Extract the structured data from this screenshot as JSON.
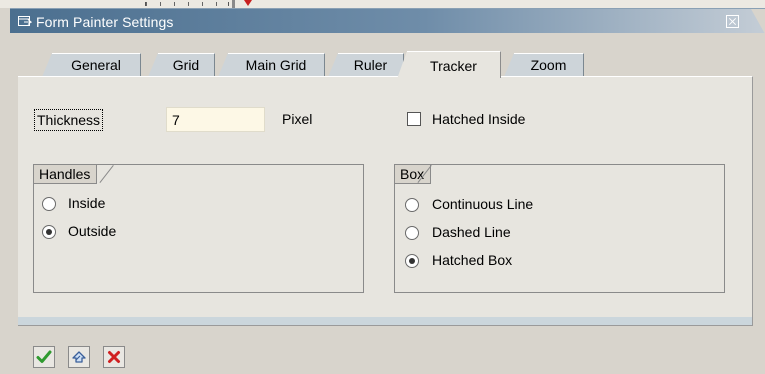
{
  "window": {
    "title": "Form Painter Settings"
  },
  "tabs": [
    {
      "label": "General",
      "active": false
    },
    {
      "label": "Grid",
      "active": false
    },
    {
      "label": "Main Grid",
      "active": false
    },
    {
      "label": "Ruler",
      "active": false
    },
    {
      "label": "Tracker",
      "active": true
    },
    {
      "label": "Zoom",
      "active": false
    }
  ],
  "tracker": {
    "thickness_label": "Thickness",
    "thickness_value": "7",
    "thickness_unit": "Pixel",
    "hatched_inside_label": "Hatched Inside",
    "hatched_inside_checked": false
  },
  "handles": {
    "title": "Handles",
    "options": [
      {
        "label": "Inside",
        "selected": false
      },
      {
        "label": "Outside",
        "selected": true
      }
    ]
  },
  "box": {
    "title": "Box",
    "options": [
      {
        "label": "Continuous Line",
        "selected": false
      },
      {
        "label": "Dashed Line",
        "selected": false
      },
      {
        "label": "Hatched Box",
        "selected": true
      }
    ]
  },
  "footer_buttons": [
    {
      "icon": "checkmark-icon",
      "color": "#2f9a2f"
    },
    {
      "icon": "copy-icon",
      "color": "#3a5f9a"
    },
    {
      "icon": "cancel-x-icon",
      "color": "#d02020"
    }
  ],
  "colors": {
    "title_bar": "#4b6f8f",
    "panel_bg": "#e7e5df",
    "input_bg": "#fdf8e6",
    "tab_bg": "#cdd4d9"
  }
}
